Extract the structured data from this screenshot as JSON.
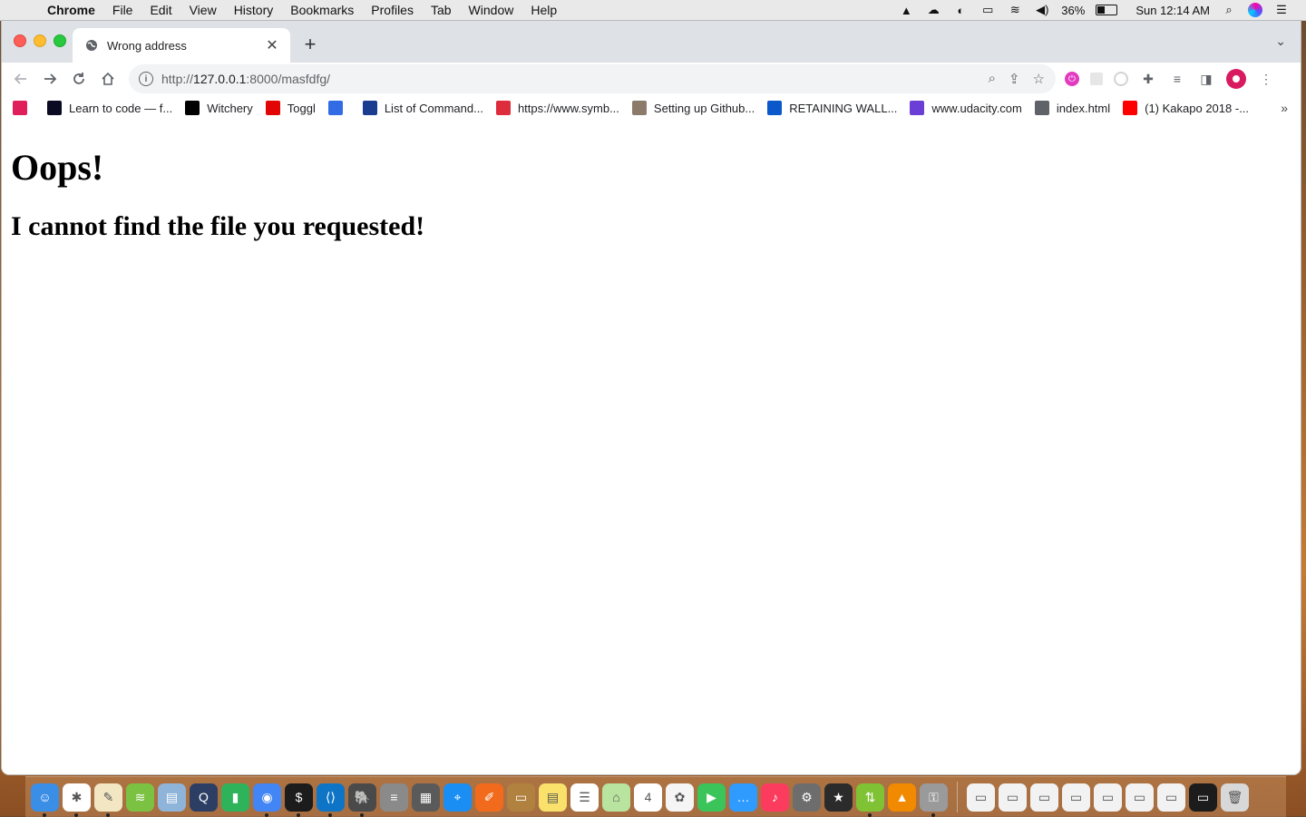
{
  "menubar": {
    "app": "Chrome",
    "items": [
      "File",
      "Edit",
      "View",
      "History",
      "Bookmarks",
      "Profiles",
      "Tab",
      "Window",
      "Help"
    ],
    "battery_percent": "36%",
    "battery_level": 0.36,
    "clock": "Sun 12:14 AM"
  },
  "tab": {
    "title": "Wrong address"
  },
  "omnibox": {
    "url_scheme": "http://",
    "url_host": "127.0.0.1",
    "url_rest": ":8000/masfdfg/"
  },
  "bookmarks": [
    {
      "label": "",
      "icon": "slack-icon",
      "color": "#e01e5a"
    },
    {
      "label": "Learn to code — f...",
      "icon": "freecodecamp-icon",
      "color": "#0a0a23"
    },
    {
      "label": "Witchery",
      "icon": "witchery-icon",
      "color": "#000000"
    },
    {
      "label": "Toggl",
      "icon": "toggl-icon",
      "color": "#e20505"
    },
    {
      "label": "",
      "icon": "kubernetes-icon",
      "color": "#326ce5"
    },
    {
      "label": "List of Command...",
      "icon": "cmd-icon",
      "color": "#1a3d8f"
    },
    {
      "label": "https://www.symb...",
      "icon": "symbolab-icon",
      "color": "#dd2c3b"
    },
    {
      "label": "Setting up Github...",
      "icon": "photo-icon",
      "color": "#8c7a6b"
    },
    {
      "label": "RETAINING WALL...",
      "icon": "link-icon",
      "color": "#0a58ca"
    },
    {
      "label": "www.udacity.com",
      "icon": "udacity-icon",
      "color": "#6b3fd6"
    },
    {
      "label": "index.html",
      "icon": "globe-icon",
      "color": "#5f6368"
    },
    {
      "label": "(1) Kakapo 2018 -...",
      "icon": "youtube-icon",
      "color": "#ff0000"
    }
  ],
  "page": {
    "heading": "Oops!",
    "subheading": "I cannot find the file you requested!"
  },
  "dock": [
    {
      "name": "finder-icon",
      "color": "#3a8ee6",
      "glyph": "☺",
      "running": true
    },
    {
      "name": "slack-icon",
      "color": "#ffffff",
      "glyph": "✱",
      "running": true
    },
    {
      "name": "textedit-icon",
      "color": "#f3e7c3",
      "glyph": "✎",
      "running": true
    },
    {
      "name": "bluestacks-icon",
      "color": "#7cc242",
      "glyph": "≋",
      "running": false
    },
    {
      "name": "preview-icon",
      "color": "#8fb4d9",
      "glyph": "▤",
      "running": false
    },
    {
      "name": "quicktime-icon",
      "color": "#2c3e63",
      "glyph": "Q",
      "running": false
    },
    {
      "name": "numbers-icon",
      "color": "#2eb35b",
      "glyph": "▮",
      "running": false
    },
    {
      "name": "chrome-icon",
      "color": "#4285f4",
      "glyph": "◉",
      "running": true
    },
    {
      "name": "terminal-icon",
      "color": "#1c1c1c",
      "glyph": "$",
      "running": true
    },
    {
      "name": "vscode-icon",
      "color": "#0e75c6",
      "glyph": "⟨⟩",
      "running": true
    },
    {
      "name": "postgres-icon",
      "color": "#4a4a4a",
      "glyph": "🐘",
      "running": true
    },
    {
      "name": "database-icon",
      "color": "#8a8a8a",
      "glyph": "≡",
      "running": false
    },
    {
      "name": "calculator-icon",
      "color": "#5a5a5a",
      "glyph": "▦",
      "running": false
    },
    {
      "name": "safari-icon",
      "color": "#1a8ef3",
      "glyph": "⌖",
      "running": false
    },
    {
      "name": "sketch-icon",
      "color": "#f26b1d",
      "glyph": "✐",
      "running": false
    },
    {
      "name": "notebook-icon",
      "color": "#b0813f",
      "glyph": "▭",
      "running": false
    },
    {
      "name": "notes-icon",
      "color": "#f9e16b",
      "glyph": "▤",
      "running": false
    },
    {
      "name": "reminders-icon",
      "color": "#ffffff",
      "glyph": "☰",
      "running": false
    },
    {
      "name": "maps-icon",
      "color": "#b9e4a0",
      "glyph": "⌂",
      "running": false
    },
    {
      "name": "calendar-icon",
      "color": "#ffffff",
      "glyph": "4",
      "running": false
    },
    {
      "name": "photos-icon",
      "color": "#f5f5f5",
      "glyph": "✿",
      "running": false
    },
    {
      "name": "facetime-icon",
      "color": "#3ac45a",
      "glyph": "▶",
      "running": false
    },
    {
      "name": "messages-icon",
      "color": "#2f9bff",
      "glyph": "…",
      "running": false
    },
    {
      "name": "music-icon",
      "color": "#fb3c5e",
      "glyph": "♪",
      "running": false
    },
    {
      "name": "system-preferences-icon",
      "color": "#6d6d6d",
      "glyph": "⚙",
      "running": false
    },
    {
      "name": "imovie-icon",
      "color": "#2b2b2b",
      "glyph": "★",
      "running": false
    },
    {
      "name": "android-file-transfer-icon",
      "color": "#7fc234",
      "glyph": "⇅",
      "running": true
    },
    {
      "name": "vlc-icon",
      "color": "#f18a00",
      "glyph": "▲",
      "running": false
    },
    {
      "name": "keychain-icon",
      "color": "#9a9a9a",
      "glyph": "⚿",
      "running": true
    },
    {
      "name": "window-thumb-icon",
      "color": "#f2f2f2",
      "glyph": "▭",
      "running": false
    },
    {
      "name": "window-thumb-icon",
      "color": "#f2f2f2",
      "glyph": "▭",
      "running": false
    },
    {
      "name": "window-thumb-icon",
      "color": "#f2f2f2",
      "glyph": "▭",
      "running": false
    },
    {
      "name": "window-thumb-icon",
      "color": "#f2f2f2",
      "glyph": "▭",
      "running": false
    },
    {
      "name": "window-thumb-icon",
      "color": "#f2f2f2",
      "glyph": "▭",
      "running": false
    },
    {
      "name": "window-thumb-icon",
      "color": "#f2f2f2",
      "glyph": "▭",
      "running": false
    },
    {
      "name": "window-thumb-icon",
      "color": "#f2f2f2",
      "glyph": "▭",
      "running": false
    },
    {
      "name": "window-thumb-icon",
      "color": "#1c1c1c",
      "glyph": "▭",
      "running": false
    },
    {
      "name": "trash-icon",
      "color": "#d8d8d8",
      "glyph": "🗑",
      "running": false
    }
  ]
}
